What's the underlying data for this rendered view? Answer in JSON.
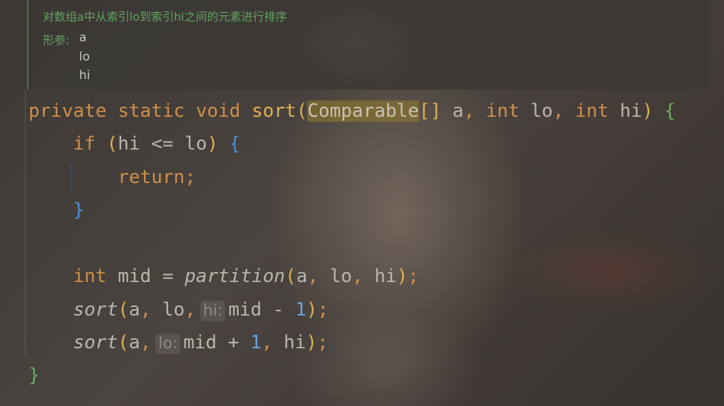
{
  "doc": {
    "description": "对数组a中从索引lo到索引hi之间的元素进行排序",
    "params_label": "形参:",
    "params": [
      "a",
      "lo",
      "hi"
    ]
  },
  "code": {
    "l1": {
      "private": "private",
      "static": "static",
      "void": "void",
      "sort": "sort",
      "open_paren": "(",
      "type": "Comparable",
      "brackets": "[]",
      "a": "a",
      "c1": ",",
      "int1": "int",
      "lo": "lo",
      "c2": ",",
      "int2": "int",
      "hi": "hi",
      "close_paren": ")",
      "brace": "{"
    },
    "l2": {
      "if": "if",
      "open_paren": "(",
      "cond": "hi <= lo",
      "close_paren": ")",
      "brace": "{"
    },
    "l3": {
      "return": "return",
      "semi": ";"
    },
    "l4": {
      "brace": "}"
    },
    "l6": {
      "int": "int",
      "decl": "mid = ",
      "fn": "partition",
      "open_paren": "(",
      "a": "a",
      "c1": ",",
      "lo": "lo",
      "c2": ",",
      "hi": "hi",
      "close_paren": ")",
      "semi": ";"
    },
    "l7": {
      "fn": "sort",
      "open_paren": "(",
      "a": "a",
      "c1": ",",
      "lo": "lo",
      "c2": ",",
      "hint": "hi:",
      "expr": "mid - ",
      "num": "1",
      "close_paren": ")",
      "semi": ";"
    },
    "l8": {
      "fn": "sort",
      "open_paren": "(",
      "a": "a",
      "c1": ",",
      "hint": "lo:",
      "expr": "mid + ",
      "num": "1",
      "c2": ",",
      "hi": "hi",
      "close_paren": ")",
      "semi": ";"
    },
    "l9": {
      "brace": "}"
    }
  }
}
